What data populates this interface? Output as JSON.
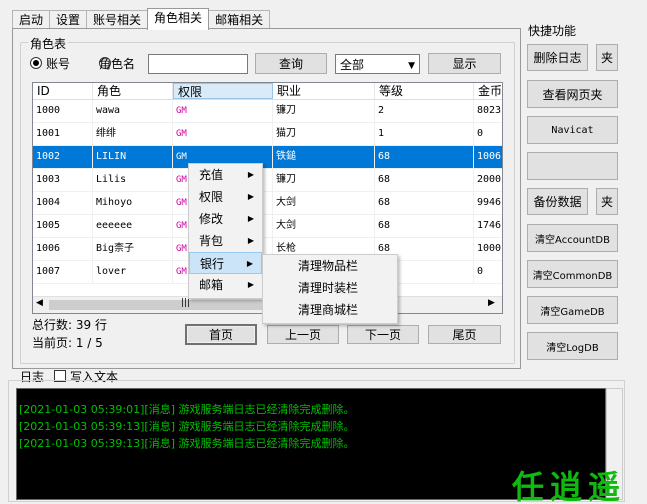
{
  "tabs": [
    "启动",
    "设置",
    "账号相关",
    "角色相关",
    "邮箱相关"
  ],
  "active_tab": 3,
  "role_table": {
    "group_title": "角色表",
    "radio_account": "账号",
    "radio_role": "角色名",
    "search_value": "",
    "query_button": "查询",
    "filter_selected": "全部",
    "show_button": "显示",
    "columns": [
      "ID",
      "角色",
      "权限",
      "职业",
      "等级",
      "金币"
    ],
    "rows": [
      [
        "1000",
        "wawa",
        "GM",
        "镰刀",
        "2",
        "8023"
      ],
      [
        "1001",
        "绯绯",
        "GM",
        "猫刀",
        "1",
        "0"
      ],
      [
        "1002",
        "LILIN",
        "GM",
        "铁鎚",
        "68",
        "1006"
      ],
      [
        "1003",
        "Lilis",
        "GM",
        "镰刀",
        "68",
        "2000"
      ],
      [
        "1004",
        "Mihoyo",
        "GM",
        "大剑",
        "68",
        "9946"
      ],
      [
        "1005",
        "eeeeee",
        "GM",
        "大剑",
        "68",
        "1746"
      ],
      [
        "1006",
        "Big柰子",
        "GM",
        "长枪",
        "68",
        "1000"
      ],
      [
        "1007",
        "lover",
        "GM",
        "",
        "",
        "0"
      ]
    ],
    "selected_row": 2,
    "total_label": "总行数:  39 行",
    "page_label": "当前页:  1 / 5",
    "first_page": "首页",
    "prev_page": "上一页",
    "next_page": "下一页",
    "last_page": "尾页"
  },
  "context_menu": [
    "充值",
    "权限",
    "修改",
    "背包",
    "银行",
    "邮箱"
  ],
  "context_menu_highlighted": 4,
  "submenu": [
    "清理物品栏",
    "清理时装栏",
    "清理商城栏"
  ],
  "quick": {
    "title": "快捷功能",
    "delete_log": "删除日志",
    "folder1": "夹",
    "view_web": "查看网页夹",
    "navicat": "Navicat",
    "empty": "",
    "backup": "备份数据",
    "folder2": "夹",
    "clear_account": "清空AccountDB",
    "clear_common": "清空CommonDB",
    "clear_game": "清空GameDB",
    "clear_log": "清空LogDB"
  },
  "log": {
    "label": "日志",
    "write_text": "写入文本",
    "lines": [
      "[2021-01-03 05:39:01][消息] 游戏服务端日志已经清除完成删除。",
      "[2021-01-03 05:39:13][消息] 游戏服务端日志已经清除完成删除。",
      "[2021-01-03 05:39:13][消息] 游戏服务端日志已经清除完成删除。"
    ]
  },
  "logo_text": "任逍遥"
}
